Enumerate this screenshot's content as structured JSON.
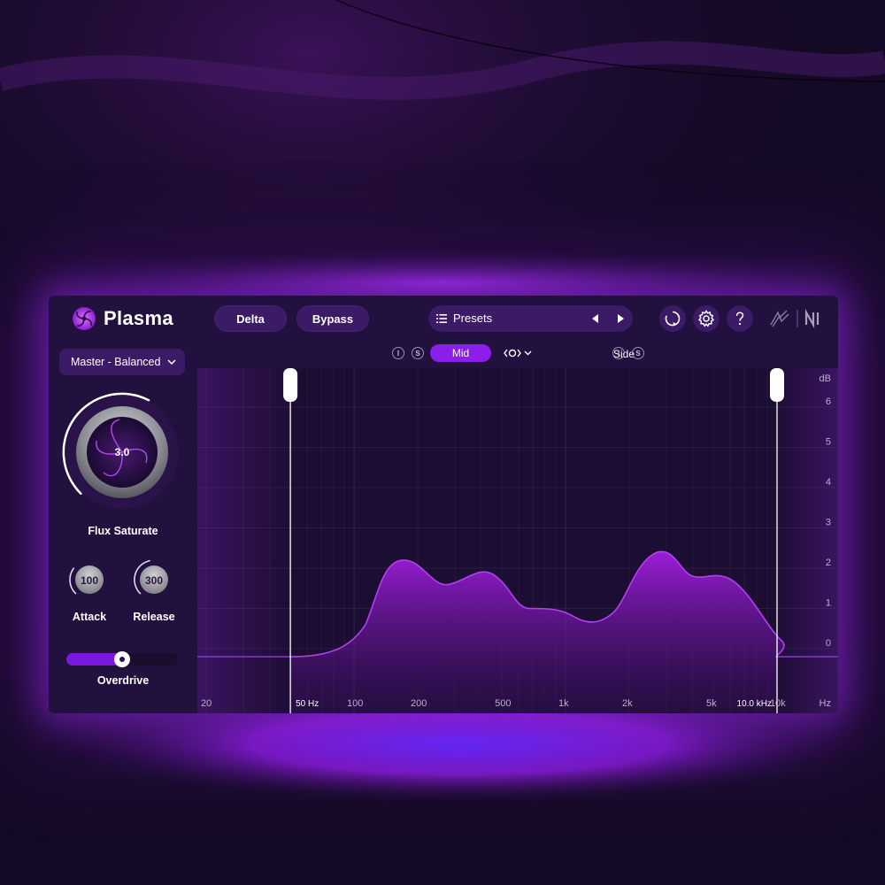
{
  "app": {
    "name": "Plasma"
  },
  "toolbar": {
    "delta_label": "Delta",
    "bypass_label": "Bypass",
    "presets_label": "Presets"
  },
  "sidebar": {
    "mode_select": "Master - Balanced",
    "flux_saturate": {
      "label": "Flux Saturate",
      "value": "3.0",
      "level": 0.6
    },
    "attack": {
      "label": "Attack",
      "value": "100",
      "level": 0.3
    },
    "release": {
      "label": "Release",
      "value": "300",
      "level": 0.45
    },
    "overdrive": {
      "label": "Overdrive",
      "level": 0.5
    }
  },
  "mid_side": {
    "mute_label": "I",
    "solo_label": "S",
    "mid_label": "Mid",
    "side_label": "Side"
  },
  "graph": {
    "db_unit": "dB",
    "hz_unit": "Hz",
    "db_ticks": [
      "6",
      "5",
      "4",
      "3",
      "2",
      "1",
      "0"
    ],
    "freq_ticks": [
      "20",
      "100",
      "200",
      "500",
      "1k",
      "2k",
      "5k",
      "10k"
    ],
    "low_band_label": "50 Hz",
    "high_band_label": "10.0 kHz",
    "low_cutoff_hz": 50,
    "high_cutoff_hz": 10000
  },
  "colors": {
    "accent": "#8b1ee8",
    "panel": "#22103e",
    "button": "#3b1a66",
    "curve": "#a21ee0"
  }
}
